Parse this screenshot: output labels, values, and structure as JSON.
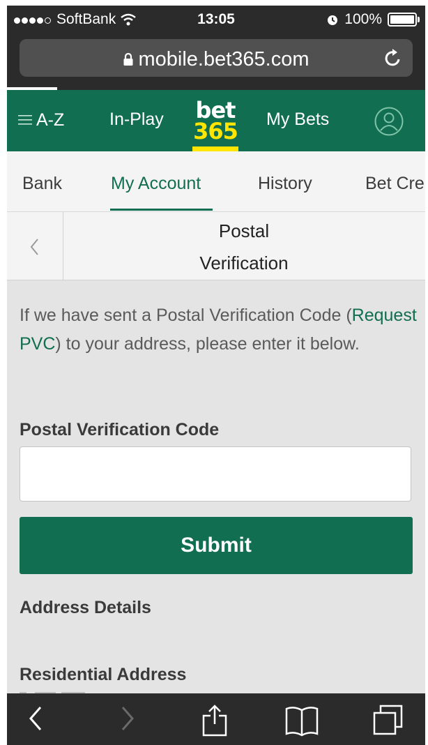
{
  "status_bar": {
    "carrier": "SoftBank",
    "time": "13:05",
    "battery": "100%",
    "battery_level": 1.0
  },
  "browser": {
    "url": "mobile.bet365.com",
    "icons": [
      "lock-icon",
      "reload-icon"
    ]
  },
  "header": {
    "az": "A-Z",
    "inplay": "In-Play",
    "logo_top": "bet",
    "logo_bottom": "365",
    "mybets": "My Bets",
    "colors": {
      "brand_green": "#126e51",
      "logo_yellow": "#ffe500"
    }
  },
  "tabs": {
    "items": [
      "Bank",
      "My Account",
      "History",
      "Bet Cre"
    ],
    "active": "My Account"
  },
  "subheader": {
    "title_line1": "Postal",
    "title_line2": "Verification"
  },
  "content": {
    "intro_before": "If we have sent a Postal Verification Code (",
    "intro_link": "Request PVC",
    "intro_after": ") to your address, please enter it below.",
    "pvc_label": "Postal Verification Code",
    "pvc_value": "",
    "submit_label": "Submit",
    "address_details": "Address Details",
    "residential_address": "Residential Address"
  },
  "toolbar": {
    "icons": [
      "back-icon",
      "forward-icon",
      "share-icon",
      "bookmarks-icon",
      "tabs-icon"
    ]
  }
}
